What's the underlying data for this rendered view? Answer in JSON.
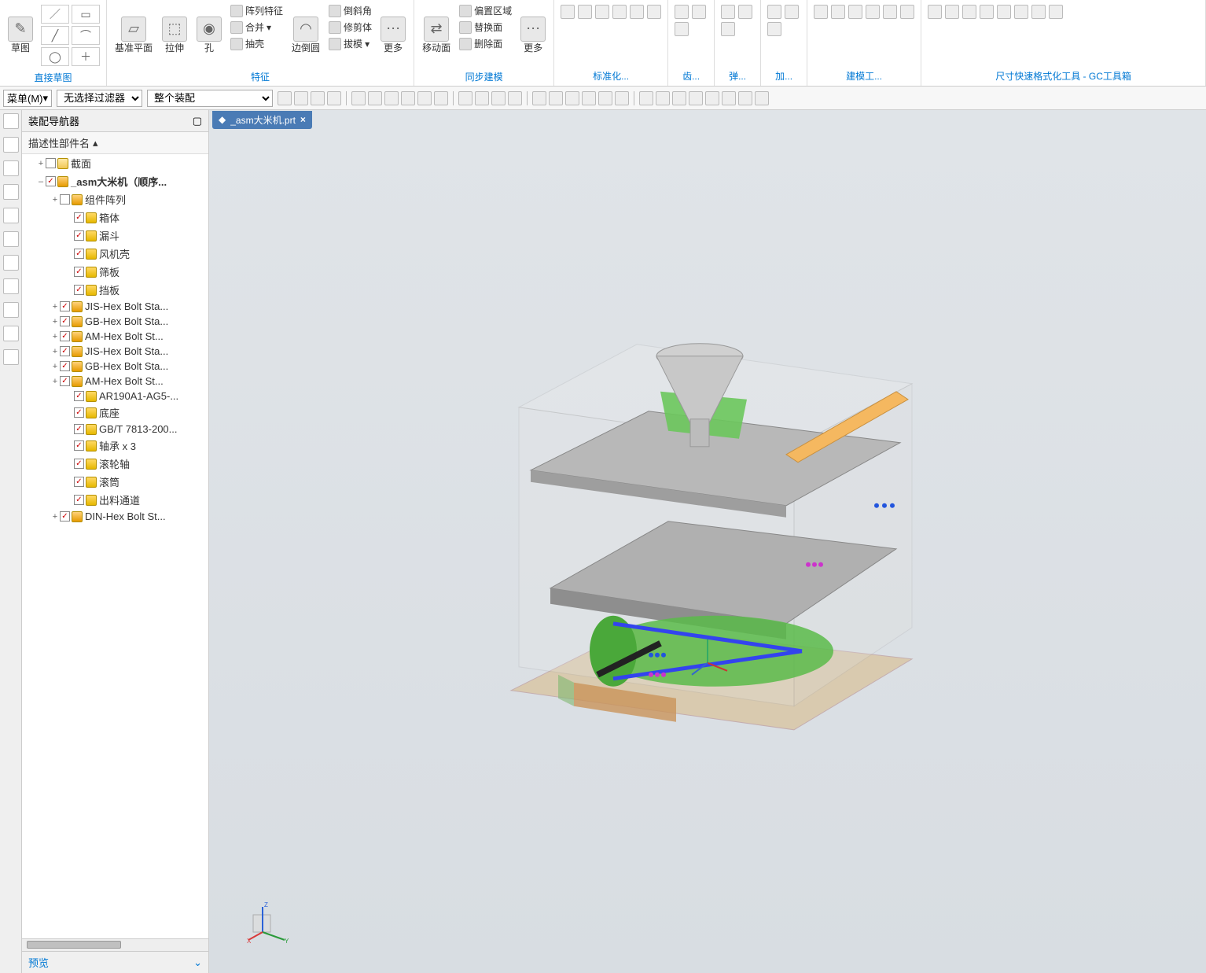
{
  "ribbon": {
    "groups": {
      "sketch": {
        "label": "直接草图",
        "btn": "草图"
      },
      "feature": {
        "label": "特征",
        "datum": "基准平面",
        "extrude": "拉伸",
        "hole": "孔",
        "edgeblend": "边倒圆",
        "more": "更多",
        "pattern": "阵列特征",
        "unite": "合并",
        "shell": "抽壳",
        "chamfer": "倒斜角",
        "trim": "修剪体",
        "draft": "拔模"
      },
      "sync": {
        "label": "同步建模",
        "moveFace": "移动面",
        "more": "更多",
        "offset": "偏置区域",
        "replace": "替换面",
        "delete": "删除面"
      },
      "std": {
        "label": "标准化..."
      },
      "gear": {
        "label": "齿..."
      },
      "spring": {
        "label": "弹..."
      },
      "add": {
        "label": "加..."
      },
      "modeltool": {
        "label": "建模工..."
      },
      "gc": {
        "label": "尺寸快速格式化工具 - GC工具箱"
      }
    }
  },
  "toolbar2": {
    "menu": "菜单(M)",
    "filter": "无选择过滤器",
    "scope": "整个装配"
  },
  "nav": {
    "title": "装配导航器",
    "header": "描述性部件名",
    "preview": "预览",
    "items": [
      {
        "indent": 1,
        "exp": "+",
        "chk": false,
        "icon": "folder",
        "label": "截面"
      },
      {
        "indent": 1,
        "exp": "–",
        "chk": true,
        "icon": "asm",
        "label": "_asm大米机（顺序...",
        "bold": true
      },
      {
        "indent": 2,
        "exp": "+",
        "chk": false,
        "icon": "asm",
        "label": "组件阵列"
      },
      {
        "indent": 3,
        "exp": "",
        "chk": true,
        "icon": "part",
        "label": "箱体"
      },
      {
        "indent": 3,
        "exp": "",
        "chk": true,
        "icon": "part",
        "label": "漏斗"
      },
      {
        "indent": 3,
        "exp": "",
        "chk": true,
        "icon": "part",
        "label": "风机壳"
      },
      {
        "indent": 3,
        "exp": "",
        "chk": true,
        "icon": "part",
        "label": "筛板"
      },
      {
        "indent": 3,
        "exp": "",
        "chk": true,
        "icon": "part",
        "label": "挡板"
      },
      {
        "indent": 2,
        "exp": "+",
        "chk": true,
        "icon": "asm",
        "label": "JIS-Hex Bolt Sta..."
      },
      {
        "indent": 2,
        "exp": "+",
        "chk": true,
        "icon": "asm",
        "label": "GB-Hex Bolt Sta..."
      },
      {
        "indent": 2,
        "exp": "+",
        "chk": true,
        "icon": "asm",
        "label": "AM-Hex Bolt St..."
      },
      {
        "indent": 2,
        "exp": "+",
        "chk": true,
        "icon": "asm",
        "label": "JIS-Hex Bolt Sta..."
      },
      {
        "indent": 2,
        "exp": "+",
        "chk": true,
        "icon": "asm",
        "label": "GB-Hex Bolt Sta..."
      },
      {
        "indent": 2,
        "exp": "+",
        "chk": true,
        "icon": "asm",
        "label": "AM-Hex Bolt St..."
      },
      {
        "indent": 3,
        "exp": "",
        "chk": true,
        "icon": "part",
        "label": "AR190A1-AG5-..."
      },
      {
        "indent": 3,
        "exp": "",
        "chk": true,
        "icon": "part",
        "label": "底座"
      },
      {
        "indent": 3,
        "exp": "",
        "chk": true,
        "icon": "part",
        "label": "GB/T 7813-200..."
      },
      {
        "indent": 3,
        "exp": "",
        "chk": true,
        "icon": "part",
        "label": "轴承 x 3"
      },
      {
        "indent": 3,
        "exp": "",
        "chk": true,
        "icon": "part",
        "label": "滚轮轴"
      },
      {
        "indent": 3,
        "exp": "",
        "chk": true,
        "icon": "part",
        "label": "滚筒"
      },
      {
        "indent": 3,
        "exp": "",
        "chk": true,
        "icon": "part",
        "label": "出料通道"
      },
      {
        "indent": 2,
        "exp": "+",
        "chk": true,
        "icon": "asm",
        "label": "DIN-Hex Bolt St..."
      }
    ]
  },
  "tab": {
    "label": "_asm大米机.prt"
  }
}
